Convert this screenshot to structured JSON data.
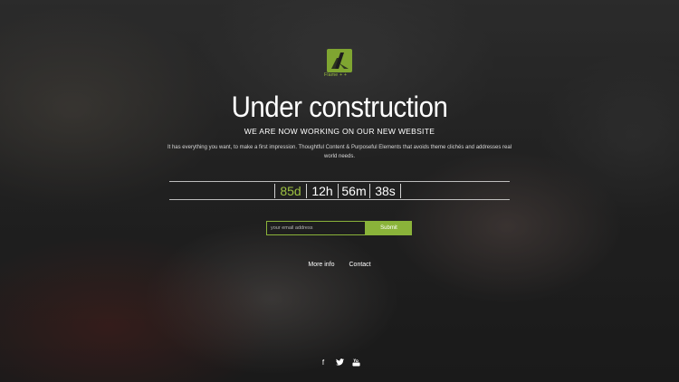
{
  "brand": {
    "logo_text": "Flame + +",
    "accent": "#8ab33a"
  },
  "hero": {
    "title": "Under construction",
    "subtitle": "WE ARE NOW WORKING ON OUR NEW WEBSITE",
    "description": "It has everything you want, to make a first impression. Thoughtful Content & Purposeful Elements that avoids theme clichés and addresses real world needs."
  },
  "countdown": {
    "days": "85d",
    "hours": "12h",
    "minutes": "56m",
    "seconds": "38s"
  },
  "subscribe": {
    "email_placeholder": "your email address",
    "submit_label": "Submit"
  },
  "links": {
    "more_info": "More info",
    "contact": "Contact"
  },
  "social": {
    "facebook": "f",
    "twitter": "t",
    "youtube": "▶"
  }
}
